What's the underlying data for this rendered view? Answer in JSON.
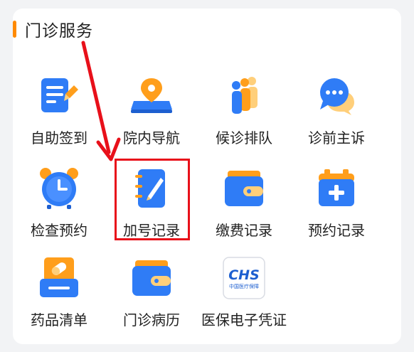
{
  "section": {
    "title": "门诊服务"
  },
  "items": [
    {
      "label": "自助签到",
      "icon": "sign-in-form-icon"
    },
    {
      "label": "院内导航",
      "icon": "location-map-icon"
    },
    {
      "label": "候诊排队",
      "icon": "queue-people-icon"
    },
    {
      "label": "诊前主诉",
      "icon": "chat-bubble-icon"
    },
    {
      "label": "检查预约",
      "icon": "alarm-clock-icon"
    },
    {
      "label": "加号记录",
      "icon": "notebook-pen-icon"
    },
    {
      "label": "缴费记录",
      "icon": "wallet-icon"
    },
    {
      "label": "预约记录",
      "icon": "medical-plus-box-icon"
    },
    {
      "label": "药品清单",
      "icon": "pill-tray-icon"
    },
    {
      "label": "门诊病历",
      "icon": "wallet-folder-icon"
    },
    {
      "label": "医保电子凭证",
      "icon": "chs-insurance-logo-icon"
    }
  ],
  "logo": {
    "chs_text": "CHS",
    "chs_subtext": "中国医疗保障"
  },
  "colors": {
    "accent": "#ff8a00",
    "icon_blue": "#2f7cf6",
    "icon_orange": "#ff9e1b",
    "annotation_red": "#e8101a"
  }
}
